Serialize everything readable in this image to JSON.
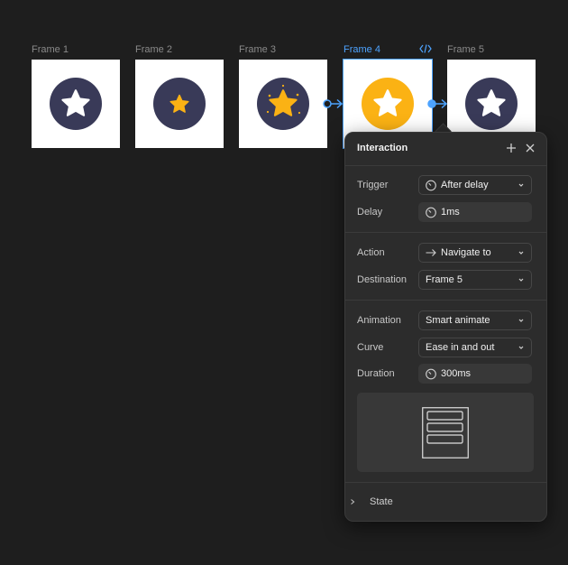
{
  "frames": [
    {
      "label": "Frame 1",
      "circle_color": "#393a58",
      "star_color": "#ffffff",
      "star_size": "large"
    },
    {
      "label": "Frame 2",
      "circle_color": "#393a58",
      "star_color": "#fbb214",
      "star_size": "small"
    },
    {
      "label": "Frame 3",
      "circle_color": "#393a58",
      "star_color": "#fbb214",
      "star_size": "large",
      "sparkles": true
    },
    {
      "label": "Frame 4",
      "circle_color": "#fbb214",
      "star_color": "#ffffff",
      "star_size": "large",
      "selected": true
    },
    {
      "label": "Frame 5",
      "circle_color": "#393a58",
      "star_color": "#ffffff",
      "star_size": "large"
    }
  ],
  "selected_frame_icon": "code-icon",
  "panel": {
    "title": "Interaction",
    "add_icon": "plus-icon",
    "close_icon": "close-icon",
    "trigger": {
      "label": "Trigger",
      "value": "After delay",
      "icon": "timer-icon"
    },
    "delay": {
      "label": "Delay",
      "value": "1ms",
      "icon": "timer-icon"
    },
    "action": {
      "label": "Action",
      "value": "Navigate to",
      "icon": "arrow-right-icon"
    },
    "destination": {
      "label": "Destination",
      "value": "Frame 5"
    },
    "animation": {
      "label": "Animation",
      "value": "Smart animate"
    },
    "curve": {
      "label": "Curve",
      "value": "Ease in and out"
    },
    "duration": {
      "label": "Duration",
      "value": "300ms",
      "icon": "timer-icon"
    },
    "state": {
      "label": "State"
    }
  },
  "colors": {
    "accent": "#4da3ff",
    "star_yellow": "#fbb214",
    "navy": "#393a58"
  }
}
